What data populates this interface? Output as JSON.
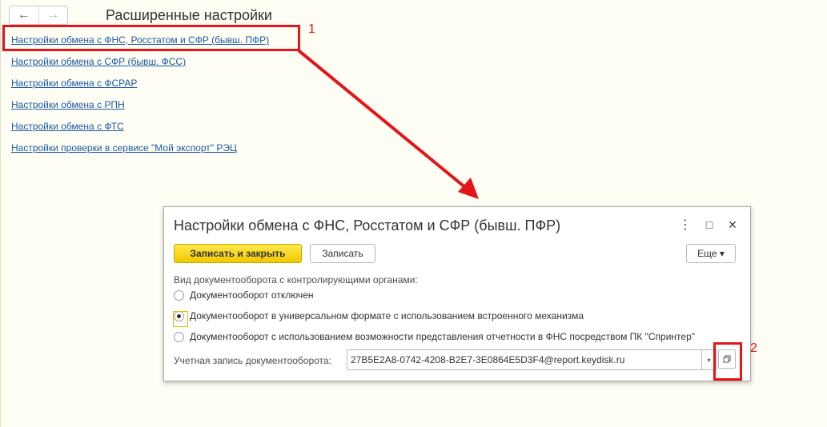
{
  "nav": {
    "back_icon": "←",
    "forward_icon": "→"
  },
  "page": {
    "title": "Расширенные настройки"
  },
  "links": [
    "Настройки обмена с ФНС, Росстатом и СФР (бывш. ПФР)",
    "Настройки обмена с СФР (бывш. ФСС)",
    "Настройки обмена с ФСРАР",
    "Настройки обмена с РПН",
    "Настройки обмена с ФТС",
    "Настройки проверки в сервисе \"Мой экспорт\" РЭЦ"
  ],
  "annotations": {
    "marker1": "1",
    "marker2": "2",
    "color": "#e4141b"
  },
  "dialog": {
    "title": "Настройки обмена с ФНС, Росстатом и СФР (бывш. ПФР)",
    "menu_icon": "⋮",
    "maximize_icon": "□",
    "close_icon": "✕",
    "save_close_label": "Записать и закрыть",
    "save_label": "Записать",
    "more_label": "Еще ▾",
    "section_label": "Вид документооборота с контролирующими органами:",
    "radio_options": [
      {
        "label": "Документооборот отключен",
        "checked": false
      },
      {
        "label": "Документооборот в универсальном формате с использованием встроенного механизма",
        "checked": true
      },
      {
        "label": "Документооборот с использованием возможности представления отчетности в ФНС посредством ПК \"Спринтер\"",
        "checked": false
      }
    ],
    "account_label": "Учетная запись документооборота:",
    "account_value": "27B5E2A8-0742-4208-B2E7-3E0864E5D3F4@report.keydisk.ru",
    "dropdown_icon": "▾"
  }
}
